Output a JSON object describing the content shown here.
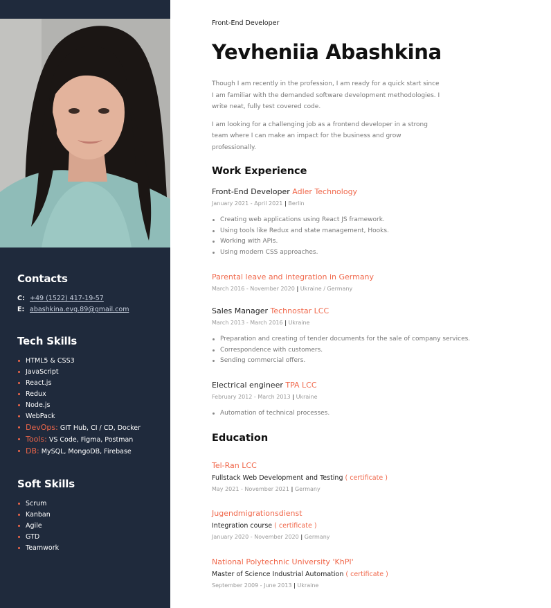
{
  "sidebar": {
    "photo_alt": "portrait",
    "contacts": {
      "title": "Contacts",
      "items": [
        {
          "key": "C:",
          "value": "+49 (1522) 417-19-57"
        },
        {
          "key": "E:",
          "value": "abashkina.evg.89@gmail.com"
        }
      ]
    },
    "tech_skills": {
      "title": "Tech Skills",
      "items": [
        {
          "label": "",
          "text": "HTML5 & CSS3"
        },
        {
          "label": "",
          "text": "JavaScript"
        },
        {
          "label": "",
          "text": "React.js"
        },
        {
          "label": "",
          "text": "Redux"
        },
        {
          "label": "",
          "text": "Node.js"
        },
        {
          "label": "",
          "text": "WebPack"
        },
        {
          "label": "DevOps:",
          "text": "GIT Hub, CI / CD, Docker"
        },
        {
          "label": "Tools:",
          "text": "VS Code, Figma, Postman"
        },
        {
          "label": "DB:",
          "text": "MySQL, MongoDB, Firebase"
        }
      ]
    },
    "soft_skills": {
      "title": "Soft Skills",
      "items": [
        "Scrum",
        "Kanban",
        "Agile",
        "GTD",
        "Teamwork"
      ]
    }
  },
  "header": {
    "subtitle": "Front-End Developer",
    "name": "Yevheniia Abashkina"
  },
  "about": [
    "Though I am recently in the profession, I am ready for a quick start since I am familiar with the demanded software development methodologies. I write neat, fully test covered code.",
    "I am looking for a challenging job as a frontend developer in a strong team where I can make an impact for the business and grow professionally."
  ],
  "work": {
    "title": "Work Experience",
    "jobs": [
      {
        "role": "Front-End Developer",
        "company": "Adler Technology",
        "dates": "January 2021 - April 2021",
        "place": "Berlin",
        "bullets": [
          "Creating web applications using React JS framework.",
          "Using tools like Redux and state management, Hooks.",
          "Working with APIs.",
          "Using modern CSS approaches."
        ]
      },
      {
        "role": "",
        "company": "Parental leave and integration in Germany",
        "dates": "March 2016 - November 2020",
        "place": "Ukraine / Germany",
        "bullets": []
      },
      {
        "role": "Sales Manager",
        "company": "Technostar LCC",
        "dates": "March 2013 - March 2016",
        "place": "Ukraine",
        "bullets": [
          "Preparation and creating of tender documents for the sale of company services.",
          "Correspondence with customers.",
          "Sending commercial offers."
        ]
      },
      {
        "role": "Electrical engineer",
        "company": "TPA LCC",
        "dates": "February 2012 - March 2013",
        "place": "Ukraine",
        "bullets": [
          "Automation of technical processes."
        ]
      }
    ]
  },
  "education": {
    "title": "Education",
    "items": [
      {
        "school": "Tel-Ran LCC",
        "course": "Fullstack Web Development and Testing",
        "cert": "( certificate )",
        "dates": "May 2021 - November 2021",
        "place": "Germany"
      },
      {
        "school": "Jugendmigrationsdienst",
        "course": "Integration course",
        "cert": "( certificate )",
        "dates": "January 2020 - November 2020",
        "place": "Germany"
      },
      {
        "school": "National Polytechnic University 'KhPI'",
        "course": "Master of Science Industrial Automation",
        "cert": "( certificate )",
        "dates": "September 2009 - June 2013",
        "place": "Ukraine"
      }
    ]
  },
  "colors": {
    "sidebar_bg": "#1f2a3c",
    "accent": "#f0674a"
  }
}
